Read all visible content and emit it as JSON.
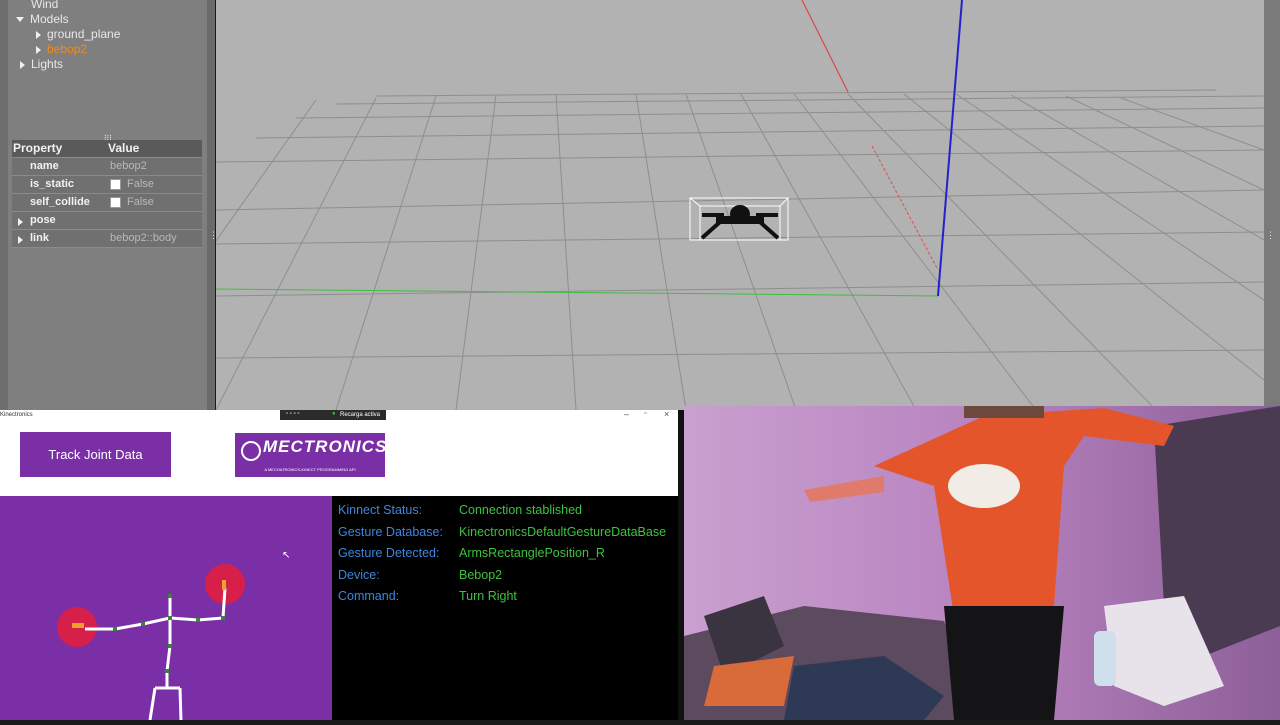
{
  "gazebo": {
    "tree": {
      "wind": "Wind",
      "models": "Models",
      "ground_plane": "ground_plane",
      "bebop2": "bebop2",
      "lights": "Lights"
    },
    "properties": {
      "header_property": "Property",
      "header_value": "Value",
      "rows": [
        {
          "key": "name",
          "value": "bebop2"
        },
        {
          "key": "is_static",
          "value": "False"
        },
        {
          "key": "self_collide",
          "value": "False"
        },
        {
          "key": "pose",
          "value": ""
        },
        {
          "key": "link",
          "value": "bebop2::body"
        }
      ]
    }
  },
  "kinectronics": {
    "window_title": "Kinectronics",
    "recording_label": "Recarga activa",
    "track_button": "Track Joint Data",
    "logo_text": "MECTRONICS",
    "logo_subtitle": "A MECHATRONICS-KINECT PROGRAMMING API",
    "status": [
      {
        "label": "Kinnect Status:",
        "value": "Connection stablished"
      },
      {
        "label": "Gesture Database:",
        "value": "KinectronicsDefaultGestureDataBase"
      },
      {
        "label": "Gesture Detected:",
        "value": "ArmsRectanglePosition_R"
      },
      {
        "label": "Device:",
        "value": "Bebop2"
      },
      {
        "label": "Command:",
        "value": "Turn Right"
      }
    ]
  },
  "colors": {
    "purple": "#7a2fa6",
    "status_label": "#3d86e0",
    "status_value": "#3dc33d",
    "selected_model": "#f08a1c"
  }
}
